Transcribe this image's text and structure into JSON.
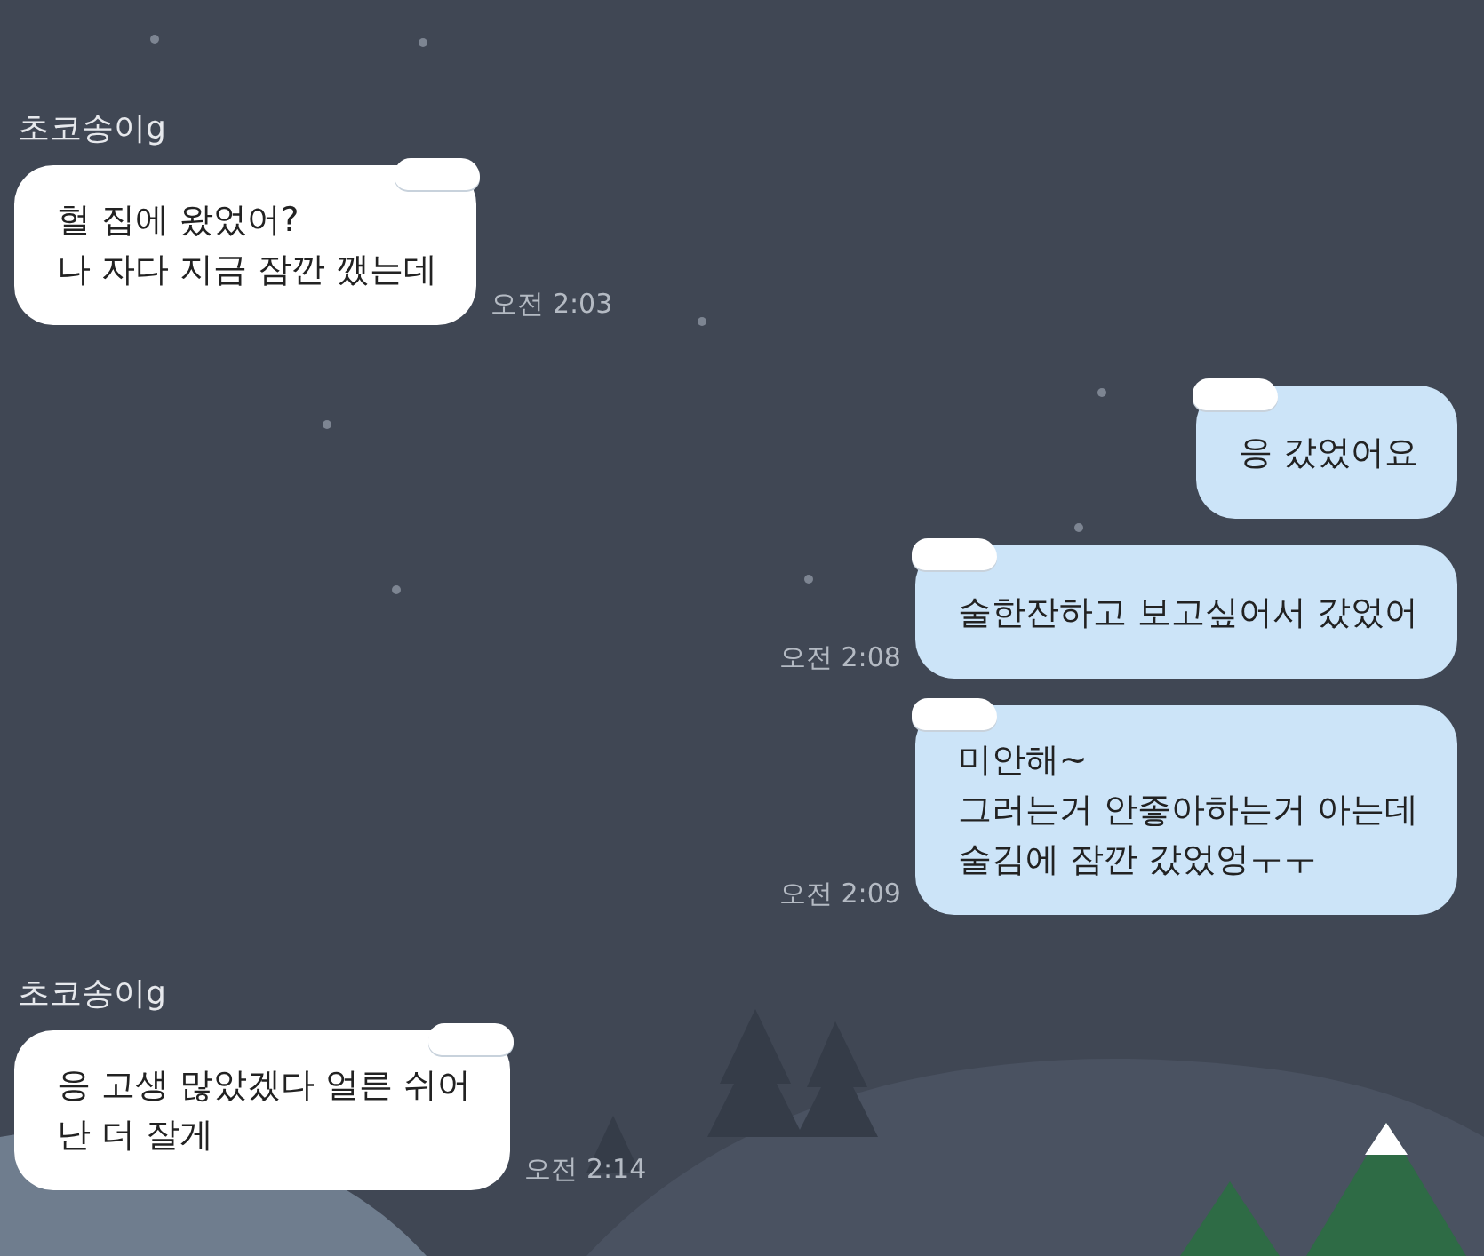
{
  "messages": [
    {
      "kind": "received",
      "sender": "초코송이g",
      "text": "헐 집에 왔었어?\n나 자다 지금 잠깐 깼는데",
      "time": "오전 2:03"
    },
    {
      "kind": "sent",
      "text": "응 갔었어요"
    },
    {
      "kind": "sent",
      "text": "술한잔하고 보고싶어서 갔었어",
      "time": "오전 2:08"
    },
    {
      "kind": "sent",
      "text": "미안해~\n그러는거 안좋아하는거 아는데\n술김에 잠깐 갔었엉ㅜㅜ",
      "time": "오전 2:09"
    },
    {
      "kind": "received",
      "sender": "초코송이g",
      "text": "응 고생 많았겠다 얼른 쉬어\n난 더 잘게",
      "time": "오전 2:14"
    }
  ]
}
